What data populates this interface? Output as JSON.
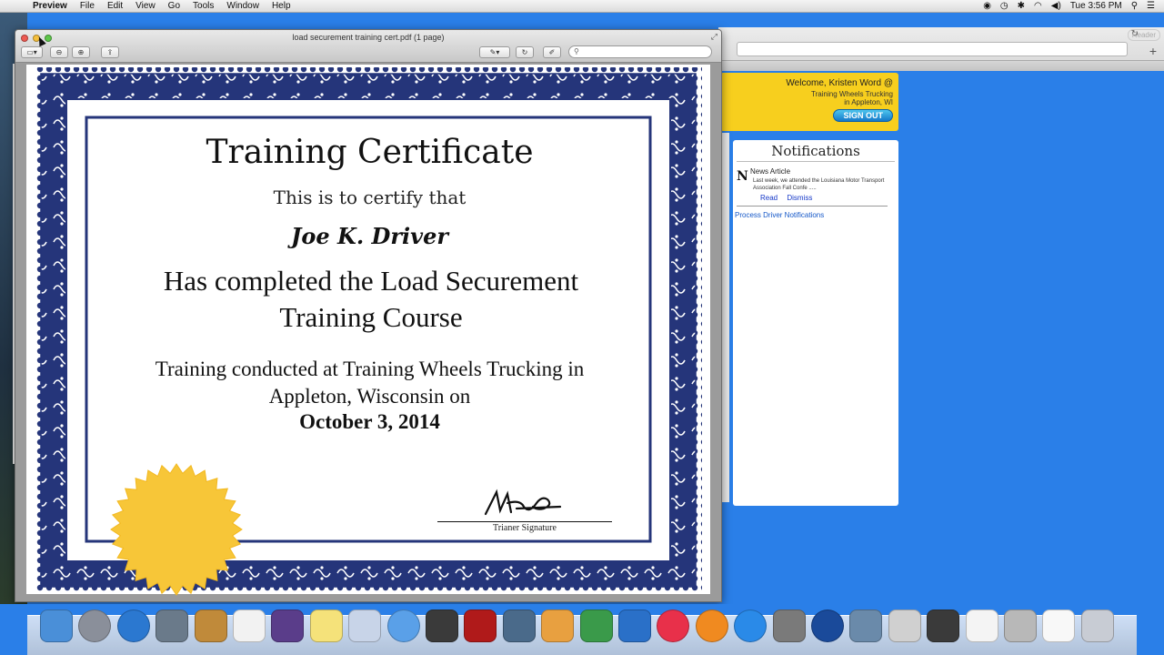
{
  "menubar": {
    "apple_icon": "apple-icon",
    "items": [
      "Preview",
      "File",
      "Edit",
      "View",
      "Go",
      "Tools",
      "Window",
      "Help"
    ],
    "clock": "Tue 3:56 PM",
    "status_icons": [
      "record-icon",
      "time-machine-icon",
      "bluetooth-icon",
      "wifi-icon",
      "volume-icon",
      "search-icon",
      "list-icon"
    ]
  },
  "preview": {
    "window_title": "load securement training cert.pdf (1 page)",
    "search_placeholder": "",
    "toolbar_icons": [
      "sidebar-icon",
      "zoom-out-icon",
      "zoom-in-icon",
      "share-icon",
      "annotate-icon",
      "rotate-icon",
      "edit-icon",
      "search-icon"
    ]
  },
  "certificate": {
    "title": "Training Certificate",
    "certify": "This is to certify that",
    "name": "Joe K. Driver",
    "completed_line1": "Has completed the Load Securement",
    "completed_line2": "Training Course",
    "conducted_line1": "Training conducted at Training Wheels Trucking in",
    "conducted_line2": "Appleton, Wisconsin on",
    "date": "October 3, 2014",
    "signature_label": "Trianer Signature",
    "border_color": "#25357a",
    "seal_color": "#f7c638"
  },
  "browser": {
    "reader_label": "Reader"
  },
  "welcome": {
    "greeting": "Welcome, Kristen Word  @",
    "company": "Training Wheels Trucking",
    "location": "in Appleton, WI",
    "signout_label": "SIGN OUT"
  },
  "notifications": {
    "title": "Notifications",
    "item_initial": "N",
    "item_title": "News Article",
    "item_body": "Last week, we attended the Louisiana Motor Transport Association Fall Confe .....",
    "read_label": "Read",
    "dismiss_label": "Dismiss",
    "process_link": "Process Driver Notifications"
  },
  "dock": {
    "icons": [
      {
        "name": "finder-icon",
        "color": "#4a8fd8"
      },
      {
        "name": "launchpad-icon",
        "color": "#8a8f9a"
      },
      {
        "name": "safari-icon",
        "color": "#2b78d0"
      },
      {
        "name": "preview-icon",
        "color": "#6a7a8a"
      },
      {
        "name": "contacts-icon",
        "color": "#c08a3a"
      },
      {
        "name": "calendar-icon",
        "color": "#f2f2f2"
      },
      {
        "name": "imovie-icon",
        "color": "#5a3d8a"
      },
      {
        "name": "stickies-icon",
        "color": "#f5e27a"
      },
      {
        "name": "mail-icon",
        "color": "#c8d4e8"
      },
      {
        "name": "messages-icon",
        "color": "#5aa0e8"
      },
      {
        "name": "facetime-icon",
        "color": "#3a3a3a"
      },
      {
        "name": "photo-booth-icon",
        "color": "#b01a1a"
      },
      {
        "name": "iphoto-icon",
        "color": "#4a6a8a"
      },
      {
        "name": "pages-icon",
        "color": "#e8a040"
      },
      {
        "name": "numbers-icon",
        "color": "#3a9a4a"
      },
      {
        "name": "keynote-icon",
        "color": "#2a70c8"
      },
      {
        "name": "itunes-icon",
        "color": "#e8304a"
      },
      {
        "name": "ibooks-icon",
        "color": "#f08a20"
      },
      {
        "name": "app-store-icon",
        "color": "#2a8ae8"
      },
      {
        "name": "system-preferences-icon",
        "color": "#7a7a7a"
      },
      {
        "name": "quicktime-icon",
        "color": "#1a4a9a"
      },
      {
        "name": "image-capture-icon",
        "color": "#6a8aaa"
      },
      {
        "name": "printer-icon",
        "color": "#d0d0d0"
      },
      {
        "name": "terminal-icon",
        "color": "#3a3a3a"
      },
      {
        "name": "document-icon",
        "color": "#f4f4f4"
      },
      {
        "name": "scanner-icon",
        "color": "#b8b8b8"
      },
      {
        "name": "pdf-document-icon",
        "color": "#f8f8f8"
      },
      {
        "name": "trash-icon",
        "color": "#c8ccd4"
      }
    ]
  }
}
